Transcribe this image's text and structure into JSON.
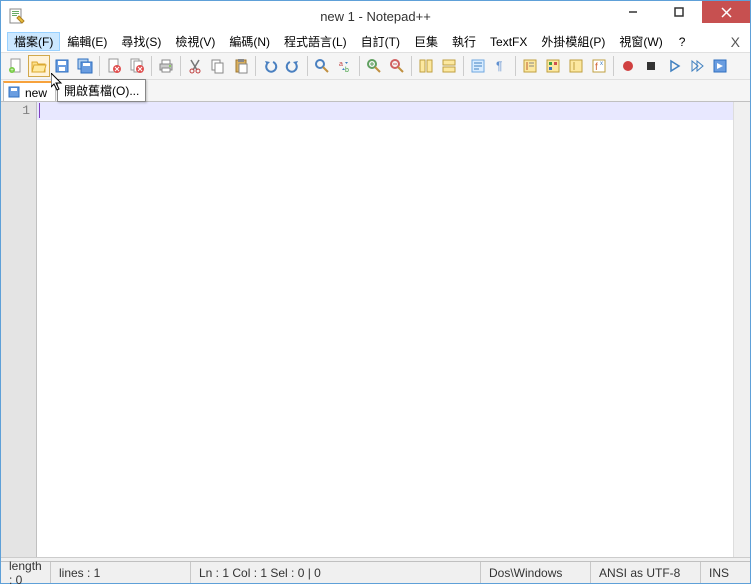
{
  "title": "new  1 - Notepad++",
  "menu": {
    "file": "檔案(F)",
    "edit": "編輯(E)",
    "search": "尋找(S)",
    "view": "檢視(V)",
    "encoding": "編碼(N)",
    "language": "程式語言(L)",
    "settings": "自訂(T)",
    "macro": "巨集",
    "run": "執行",
    "textfx": "TextFX",
    "plugins": "外掛模組(P)",
    "window": "視窗(W)",
    "help": "?"
  },
  "tooltip": "開啟舊檔(O)...",
  "tab": {
    "label": "new"
  },
  "gutter": {
    "line1": "1"
  },
  "status": {
    "length": "length : 0",
    "lines": "lines : 1",
    "pos": "Ln : 1    Col : 1    Sel : 0 | 0",
    "eol": "Dos\\Windows",
    "enc": "ANSI as UTF-8",
    "ins": "INS"
  }
}
